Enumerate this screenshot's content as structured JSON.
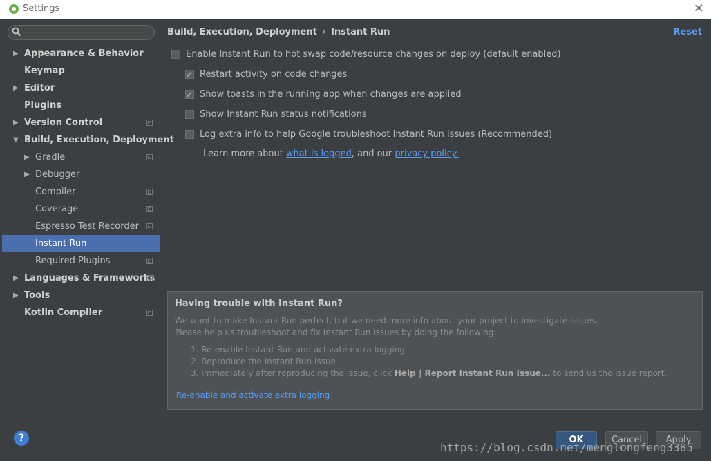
{
  "window": {
    "title": "Settings",
    "accent": "#4b6eaf",
    "link_color": "#589df6"
  },
  "search": {
    "placeholder": "",
    "value": ""
  },
  "sidebar": {
    "items": [
      {
        "label": "Appearance & Behavior",
        "level": 0,
        "expandable": true,
        "expanded": false,
        "config_icon": false,
        "selected": false
      },
      {
        "label": "Keymap",
        "level": 0,
        "expandable": false,
        "config_icon": false,
        "selected": false
      },
      {
        "label": "Editor",
        "level": 0,
        "expandable": true,
        "expanded": false,
        "config_icon": false,
        "selected": false
      },
      {
        "label": "Plugins",
        "level": 0,
        "expandable": false,
        "config_icon": false,
        "selected": false
      },
      {
        "label": "Version Control",
        "level": 0,
        "expandable": true,
        "expanded": false,
        "config_icon": true,
        "selected": false
      },
      {
        "label": "Build, Execution, Deployment",
        "level": 0,
        "expandable": true,
        "expanded": true,
        "config_icon": false,
        "selected": false
      },
      {
        "label": "Gradle",
        "level": 1,
        "expandable": true,
        "expanded": false,
        "config_icon": true,
        "selected": false
      },
      {
        "label": "Debugger",
        "level": 1,
        "expandable": true,
        "expanded": false,
        "config_icon": false,
        "selected": false
      },
      {
        "label": "Compiler",
        "level": 1,
        "expandable": false,
        "config_icon": true,
        "selected": false
      },
      {
        "label": "Coverage",
        "level": 1,
        "expandable": false,
        "config_icon": true,
        "selected": false
      },
      {
        "label": "Espresso Test Recorder",
        "level": 1,
        "expandable": false,
        "config_icon": true,
        "selected": false
      },
      {
        "label": "Instant Run",
        "level": 1,
        "expandable": false,
        "config_icon": false,
        "selected": true
      },
      {
        "label": "Required Plugins",
        "level": 1,
        "expandable": false,
        "config_icon": true,
        "selected": false
      },
      {
        "label": "Languages & Frameworks",
        "level": 0,
        "expandable": true,
        "expanded": false,
        "config_icon": true,
        "selected": false
      },
      {
        "label": "Tools",
        "level": 0,
        "expandable": true,
        "expanded": false,
        "config_icon": false,
        "selected": false
      },
      {
        "label": "Kotlin Compiler",
        "level": 0,
        "expandable": false,
        "config_icon": true,
        "selected": false
      }
    ]
  },
  "content": {
    "breadcrumb": {
      "parent": "Build, Execution, Deployment",
      "separator": "›",
      "current": "Instant Run"
    },
    "reset_label": "Reset",
    "options": [
      {
        "label": "Enable Instant Run to hot swap code/resource changes on deploy (default enabled)",
        "checked": false,
        "indent": 0
      },
      {
        "label": "Restart activity on code changes",
        "checked": true,
        "indent": 1
      },
      {
        "label": "Show toasts in the running app when changes are applied",
        "checked": true,
        "indent": 1
      },
      {
        "label": "Show Instant Run status notifications",
        "checked": false,
        "indent": 1
      },
      {
        "label": "Log extra info to help Google troubleshoot Instant Run issues (Recommended)",
        "checked": false,
        "indent": 1
      }
    ],
    "learn_more": {
      "prefix": "Learn more about ",
      "link1": "what is logged",
      "middle": ", and our ",
      "link2": "privacy policy."
    }
  },
  "trouble_panel": {
    "heading": "Having trouble with Instant Run?",
    "line1": "We want to make Instant Run perfect, but we need more info about your project to investigate issues.",
    "line2": "Please help us troubleshoot and fix Instant Run issues by doing the following:",
    "steps": [
      "1. Re-enable Instant Run and activate extra logging",
      "2. Reproduce the Instant Run issue"
    ],
    "step3_prefix": "3. Immediately after reproducing the issue, click ",
    "step3_bold": "Help | Report Instant Run Issue...",
    "step3_suffix": " to send us the issue report.",
    "link": "Re-enable and activate extra logging"
  },
  "footer": {
    "help_label": "?",
    "ok_label": "OK",
    "cancel_label": "Cancel",
    "apply_label": "Apply"
  },
  "watermark": "https://blog.csdn.net/menglongfeng3385"
}
